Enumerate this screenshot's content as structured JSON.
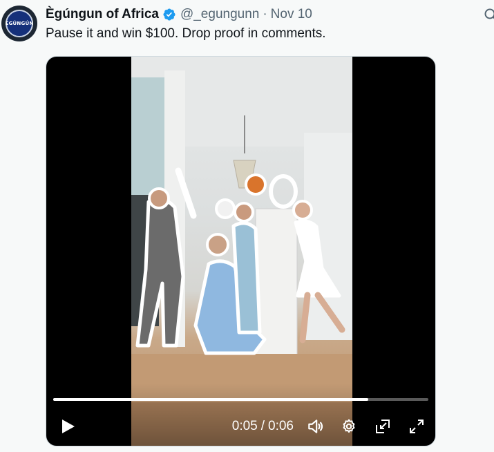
{
  "author": {
    "display_name": "Ègúngun of Africa",
    "handle": "@_egungunn",
    "separator": "·",
    "date": "Nov 10",
    "avatar_text": "EGÚNGÚN",
    "verified": true,
    "verified_color": "#1d9bf0"
  },
  "tweet": {
    "text": "Pause it and win $100. Drop proof in comments."
  },
  "video": {
    "current_time": "0:05",
    "separator": "/",
    "duration": "0:06",
    "progress_fraction": 0.84
  },
  "icons": {
    "play": "play-icon",
    "volume": "volume-icon",
    "settings": "gear-icon",
    "dock": "picture-in-picture-icon",
    "fullscreen": "fullscreen-icon",
    "grok": "grok-icon"
  }
}
